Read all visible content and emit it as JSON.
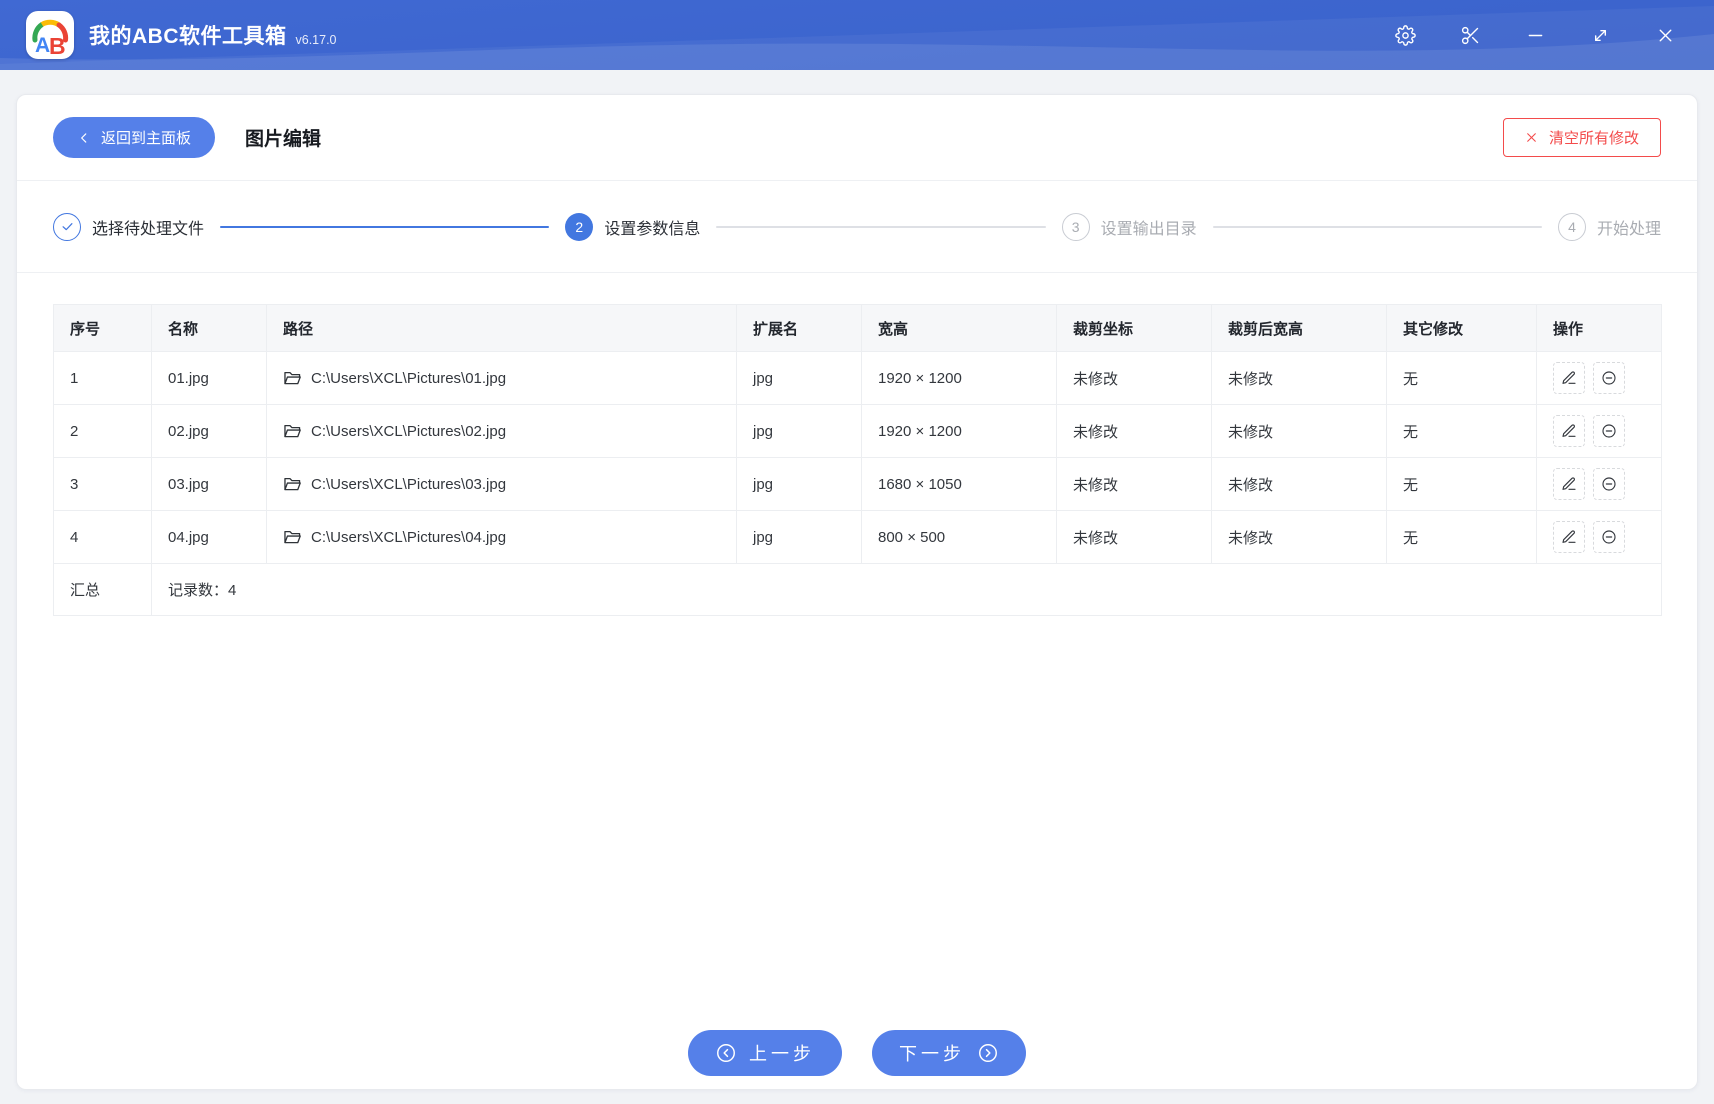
{
  "titlebar": {
    "logo_a": "A",
    "logo_b": "B",
    "app_name": "我的ABC软件工具箱",
    "version": "v6.17.0",
    "window_icons": [
      "settings-icon",
      "scissors-icon",
      "minimize-icon",
      "resize-icon",
      "close-icon"
    ]
  },
  "header": {
    "back_label": "返回到主面板",
    "page_title": "图片编辑",
    "clear_label": "清空所有修改"
  },
  "steps": [
    {
      "number": "1",
      "label": "选择待处理文件",
      "state": "done"
    },
    {
      "number": "2",
      "label": "设置参数信息",
      "state": "active"
    },
    {
      "number": "3",
      "label": "设置输出目录",
      "state": "pending"
    },
    {
      "number": "4",
      "label": "开始处理",
      "state": "pending"
    }
  ],
  "table": {
    "columns": [
      "序号",
      "名称",
      "路径",
      "扩展名",
      "宽高",
      "裁剪坐标",
      "裁剪后宽高",
      "其它修改",
      "操作"
    ],
    "rows": [
      {
        "index": "1",
        "name": "01.jpg",
        "path": "C:\\Users\\XCL\\Pictures\\01.jpg",
        "ext": "jpg",
        "size": "1920 × 1200",
        "crop_coord": "未修改",
        "crop_size": "未修改",
        "other": "无"
      },
      {
        "index": "2",
        "name": "02.jpg",
        "path": "C:\\Users\\XCL\\Pictures\\02.jpg",
        "ext": "jpg",
        "size": "1920 × 1200",
        "crop_coord": "未修改",
        "crop_size": "未修改",
        "other": "无"
      },
      {
        "index": "3",
        "name": "03.jpg",
        "path": "C:\\Users\\XCL\\Pictures\\03.jpg",
        "ext": "jpg",
        "size": "1680 × 1050",
        "crop_coord": "未修改",
        "crop_size": "未修改",
        "other": "无"
      },
      {
        "index": "4",
        "name": "04.jpg",
        "path": "C:\\Users\\XCL\\Pictures\\04.jpg",
        "ext": "jpg",
        "size": "800 × 500",
        "crop_coord": "未修改",
        "crop_size": "未修改",
        "other": "无"
      }
    ],
    "summary_label": "汇总",
    "summary_value": "记录数：4",
    "row_action_icons": [
      "edit-icon",
      "remove-icon"
    ]
  },
  "footer": {
    "prev_label": "上一步",
    "next_label": "下一步"
  },
  "colors": {
    "titlebar_blue": "#3B63CC",
    "accent_blue": "#5580E9",
    "step_blue": "#4277E0",
    "danger_red": "#F34B4B",
    "muted_gray": "#ACB0B6",
    "header_bg": "#F6F7F9"
  }
}
